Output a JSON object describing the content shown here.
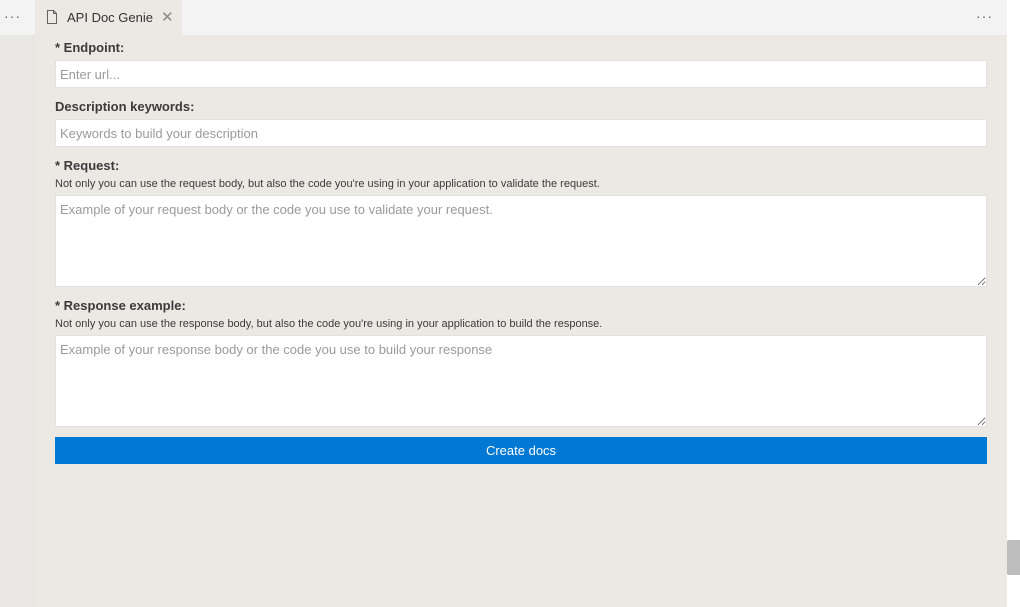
{
  "tab": {
    "title": "API Doc Genie",
    "file_icon": "file-icon",
    "close_icon": "close-icon"
  },
  "menus": {
    "more_left": "···",
    "more_right": "···"
  },
  "form": {
    "endpoint": {
      "label": "* Endpoint:",
      "placeholder": "Enter url..."
    },
    "description": {
      "label": "Description keywords:",
      "placeholder": "Keywords to build your description"
    },
    "request": {
      "label": "* Request:",
      "hint": "Not only you can use the request body, but also the code you're using in your application to validate the request.",
      "placeholder": "Example of your request body or the code you use to validate your request."
    },
    "response": {
      "label": "* Response example:",
      "hint": "Not only you can use the response body, but also the code you're using in your application to build the response.",
      "placeholder": "Example of your response body or the code you use to build your response"
    },
    "submit_label": "Create docs"
  },
  "colors": {
    "accent": "#0078d4",
    "background": "#ece9e5",
    "tabbar": "#f3f3f3"
  }
}
